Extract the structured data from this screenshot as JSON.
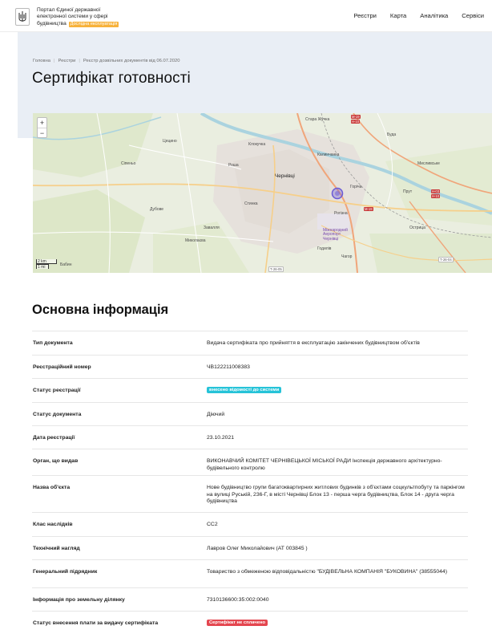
{
  "header": {
    "brand_line1": "Портал Єдиної державної",
    "brand_line2": "електронної системи у сфері",
    "brand_line3": "будівництва",
    "brand_badge": "Дослідна експлуатація",
    "nav": [
      "Реєстри",
      "Карта",
      "Аналітика",
      "Сервіси"
    ]
  },
  "breadcrumb": [
    "Головна",
    "Реєстри",
    "Реєстр дозвільних документів від 06.07.2020"
  ],
  "page_title": "Сертифікат готовності",
  "map": {
    "zoom_in": "+",
    "zoom_out": "−",
    "scale_km": "2 km",
    "scale_mi": "1 mi",
    "labels": [
      "Стара Жучка",
      "Клокучка",
      "Калинчанка",
      "Чернівці",
      "Рошa",
      "Стинка",
      "Горіча",
      "Прут",
      "Рогізна",
      "Острица",
      "Дубове",
      "Завалля",
      "Миколаєва",
      "Годилів",
      "Чагор",
      "Мисливське",
      "Міжнародний Аеропорт Чернівці",
      "Сіпеньо",
      "Цецино",
      "Бабин",
      "Буда"
    ],
    "roads": [
      "М-19",
      "Н-10",
      "Н-03",
      "Т-26-05",
      "Т-26-04"
    ],
    "accent": "#6a5ad6"
  },
  "section_title": "Основна інформація",
  "info_rows": [
    {
      "key": "Тип документа",
      "value": "Видача сертифіката про прийняття в експлуатацію закінчених будівництвом об'єктів"
    },
    {
      "key": "Реєстраційний номер",
      "value": "ЧВ122211008383"
    },
    {
      "key": "Статус реєстрації",
      "tag": "внесено відомості до системи",
      "tag_color": "#26c3d8"
    },
    {
      "key": "Статус документа",
      "value": "Діючий"
    },
    {
      "key": "Дата реєстрації",
      "value": "23.10.2021"
    },
    {
      "key": "Орган, що видав",
      "value": "ВИКОНАВЧИЙ КОМІТЕТ ЧЕРНІВЕЦЬКОЇ МІСЬКОЇ РАДИ Інспекція державного архітектурно-будівельного контролю"
    },
    {
      "key": "Назва об'єкта",
      "value": "Нове будівництво групи багатоквартирних житлових будинків з об'єктами соцкультпобуту та паркінгом на вулиці Руській, 236-Г, в місті Чернівці Блок 13 - перша черга будівництва, Блок 14 - друга черга будівництва"
    },
    {
      "key": "Клас наслідків",
      "value": "СС2"
    },
    {
      "key": "Технічний нагляд",
      "value": "Лавров Олег Миколайович (АТ 003845 )"
    },
    {
      "key": "Генеральний підрядник",
      "value": "Товариство з обмеженою відповідальністю \"БУДІВЕЛЬНА КОМПАНІЯ \"БУКОВИНА\" (38555044)"
    },
    {
      "key": "Інформація про земельну ділянку",
      "value": "7310136600:35:002:0040"
    },
    {
      "key": "Статус внесення плати за видачу сертифіката",
      "tag": "Сертифікат не сплачено",
      "tag_color": "#e4464f"
    }
  ]
}
